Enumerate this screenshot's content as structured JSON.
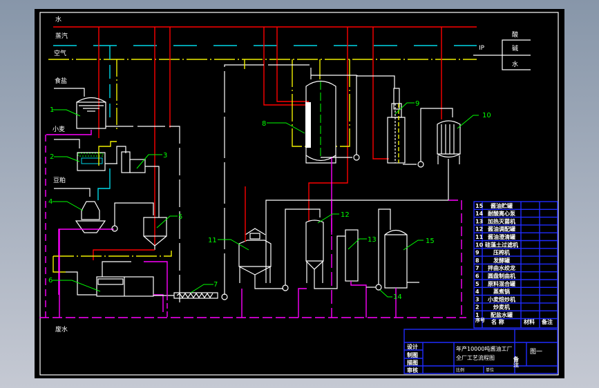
{
  "drawing": {
    "feed_lines": {
      "water": "水",
      "steam": "蒸汽",
      "air": "空气"
    },
    "inputs": {
      "salt": "食盐",
      "wheat": "小麦",
      "soybean_meal": "豆粕",
      "wastewater": "废水"
    },
    "cip": {
      "label": "IP",
      "acid": "酸",
      "alkali": "碱",
      "water": "水"
    },
    "equipment_numbers": [
      "1",
      "2",
      "3",
      "4",
      "5",
      "6",
      "7",
      "8",
      "9",
      "10",
      "11",
      "12",
      "13",
      "14",
      "15"
    ],
    "colors": {
      "water": "#ff0000",
      "steam": "#00d8e8",
      "air": "#f0f000",
      "wastewater": "#ff00ff",
      "leaders": "#00ff00",
      "table_lines": "#1f2cff"
    }
  },
  "parts_table": {
    "headers": {
      "no": "序号",
      "name": "名  称",
      "material": "材料",
      "remark": "备注"
    },
    "rows": [
      {
        "no": "15",
        "name": "酱油贮罐"
      },
      {
        "no": "14",
        "name": "耐酸离心泵"
      },
      {
        "no": "13",
        "name": "加热灭菌机"
      },
      {
        "no": "12",
        "name": "酱油调配罐"
      },
      {
        "no": "11",
        "name": "酱油澄清罐"
      },
      {
        "no": "10",
        "name": "硅藻土过滤机"
      },
      {
        "no": "9",
        "name": "压榨机"
      },
      {
        "no": "8",
        "name": "发酵罐"
      },
      {
        "no": "7",
        "name": "拌曲水绞龙"
      },
      {
        "no": "6",
        "name": "圆盘制曲机"
      },
      {
        "no": "5",
        "name": "原料混合罐"
      },
      {
        "no": "4",
        "name": "蒸煮锅"
      },
      {
        "no": "3",
        "name": "小麦焙炒机"
      },
      {
        "no": "2",
        "name": "炒麦机"
      },
      {
        "no": "1",
        "name": "配盐水罐"
      }
    ]
  },
  "title_block": {
    "design": "设计",
    "draw": "制图",
    "trace": "描图",
    "review": "审核",
    "title_line1": "年产10000吨酱油工厂",
    "title_line2": "全厂工艺流程图",
    "remark": "备注",
    "figure": "图一",
    "scale": "比例",
    "unit": "单位"
  }
}
